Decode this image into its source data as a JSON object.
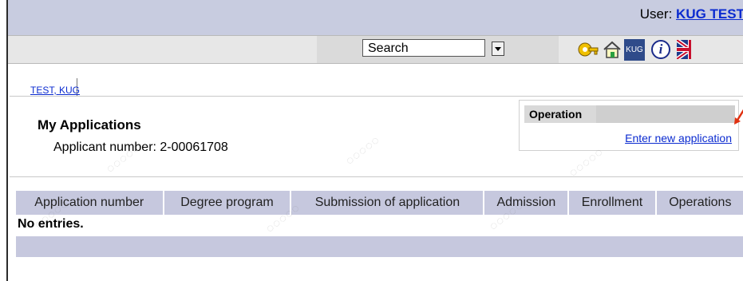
{
  "header": {
    "user_label": "User:",
    "user_name": "KUG TEST"
  },
  "toolbar": {
    "search_value": "Search",
    "icons": [
      "key-icon",
      "home-icon",
      "kug-logo-icon",
      "info-icon",
      "uk-flag-icon"
    ],
    "kug_label": "KUG",
    "info_label": "i"
  },
  "tabs": [
    {
      "label": "TEST, KUG"
    }
  ],
  "main": {
    "title": "My Applications",
    "applicant_label": "Applicant number: 2-00061708"
  },
  "operation_box": {
    "header": "Operation",
    "link": "Enter new application"
  },
  "table": {
    "columns": [
      "Application number",
      "Degree program",
      "Submission of application",
      "Admission",
      "Enrollment",
      "Operations"
    ],
    "empty_text": "No entries."
  },
  "colors": {
    "header_bg": "#c8cce0",
    "link": "#0b2bd0",
    "table_header_bg": "#c6c8de"
  }
}
